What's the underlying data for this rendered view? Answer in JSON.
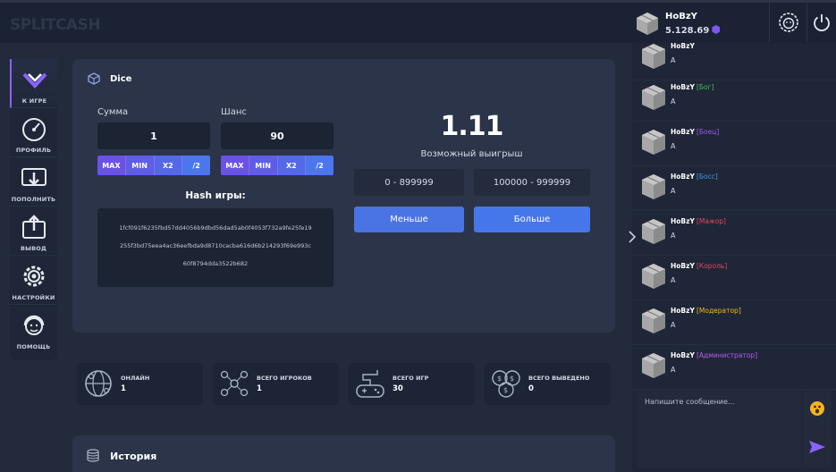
{
  "brand": {
    "logo": "SPLITCASH"
  },
  "user": {
    "name": "HoBzY",
    "balance": "5.128.69"
  },
  "colors": {
    "accent": "#7d58f0",
    "primary_blue": "#4a73e3",
    "bg": "#222a3c",
    "card": "#2c3449"
  },
  "sidebar": {
    "items": [
      {
        "label": "К ИГРЕ",
        "icon": "chevron-down-icon",
        "active": true
      },
      {
        "label": "ПРОФИЛЬ",
        "icon": "speedometer-icon"
      },
      {
        "label": "ПОПОЛНИТЬ",
        "icon": "deposit-icon"
      },
      {
        "label": "ВЫВОД",
        "icon": "withdraw-icon"
      },
      {
        "label": "НАСТРОЙКИ",
        "icon": "gear-icon"
      },
      {
        "label": "ПОМОЩЬ",
        "icon": "support-icon"
      }
    ]
  },
  "game": {
    "title": "Dice",
    "amount_label": "Сумма",
    "amount_value": "1",
    "chance_label": "Шанс",
    "chance_value": "90",
    "quick_buttons": [
      "MAX",
      "MIN",
      "X2",
      "/2"
    ],
    "hash_title": "Hash игры:",
    "hash_lines": [
      "1fcf091f6235fbd57dd4056b9dbd56dad5ab0f4053f732a9fe25fe19",
      "255f3bd75eea4ac36eefbda9d8710cacba616d6b214293f69e993c",
      "60f8794dda3522b682"
    ],
    "multiplier": "1.11",
    "multiplier_label": "Возможный выигрыш",
    "range_low": "0 - 899999",
    "range_high": "100000 - 999999",
    "bet_low_label": "Меньше",
    "bet_high_label": "Больше"
  },
  "stats": [
    {
      "label": "ОНЛАЙН",
      "value": "1",
      "icon": "globe-icon"
    },
    {
      "label": "ВСЕГО ИГРОКОВ",
      "value": "1",
      "icon": "players-network-icon"
    },
    {
      "label": "ВСЕГО ИГР",
      "value": "30",
      "icon": "gamepad-icon"
    },
    {
      "label": "ВСЕГО ВЫВЕДЕНО",
      "value": "0",
      "icon": "coins-icon"
    }
  ],
  "history": {
    "title": "История"
  },
  "chat": {
    "messages": [
      {
        "name": "HoBzY",
        "role": "",
        "text": "A",
        "role_color": "#ff4d6a"
      },
      {
        "name": "HoBzY",
        "role": "[Бог]",
        "text": "A",
        "role_color": "#3fbf57"
      },
      {
        "name": "HoBzY",
        "role": "[Боец]",
        "text": "A",
        "role_color": "#9b5cf6"
      },
      {
        "name": "HoBzY",
        "role": "[Босс]",
        "text": "A",
        "role_color": "#3b9ee8"
      },
      {
        "name": "HoBzY",
        "role": "[Мажор]",
        "text": "A",
        "role_color": "#e8455e"
      },
      {
        "name": "HoBzY",
        "role": "[Король]",
        "text": "A",
        "role_color": "#e8455e"
      },
      {
        "name": "HoBzY",
        "role": "[Модератор]",
        "text": "A",
        "role_color": "#f2b81c"
      },
      {
        "name": "HoBzY",
        "role": "[Администратор]",
        "text": "A",
        "role_color": "#b65cf0"
      }
    ],
    "input_placeholder": "Напишите сообщение..."
  }
}
